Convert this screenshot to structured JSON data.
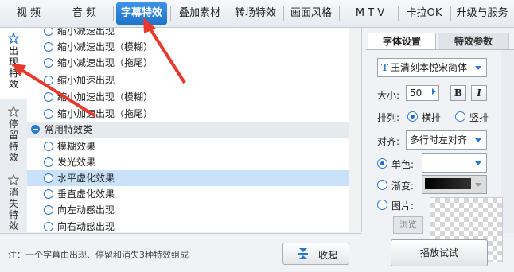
{
  "topbar": {
    "tabs": [
      "视 频",
      "音 频",
      "字幕特效",
      "叠加素材",
      "转场特效",
      "画面风格",
      "M T V",
      "卡拉OK",
      "升级与服务"
    ],
    "active_index": 2
  },
  "left_tabs": [
    {
      "label": "出\n现\n特\n效",
      "active": true
    },
    {
      "label": "停\n留\n特\n效",
      "active": false
    },
    {
      "label": "消\n失\n特\n效",
      "active": false
    }
  ],
  "list": {
    "items_top": [
      "缩小减速出现",
      "缩小减速出现（模糊）",
      "缩小减速出现（拖尾）",
      "缩小加速出现",
      "缩小加速出现（模糊）",
      "缩小加速出现（拖尾）"
    ],
    "group_label": "常用特效类",
    "items_group": [
      "模糊效果",
      "发光效果",
      "水平虚化效果",
      "垂直虚化效果",
      "向左动感出现",
      "向右动感出现"
    ],
    "selected": "水平虚化效果"
  },
  "bottom": {
    "note": "注：一个字幕由出现、停留和消失3种特效组成",
    "collapse_label": "收起"
  },
  "right": {
    "tabs": [
      "字体设置",
      "特效参数"
    ],
    "font_name": "王清刻本悦宋简体",
    "size_label": "大小:",
    "size_value": "50",
    "bold_label": "B",
    "italic_label": "I",
    "arrange_label": "排列:",
    "arrange_options": [
      "横排",
      "竖排"
    ],
    "align_label": "对齐:",
    "align_value": "多行时左对齐",
    "single_color_label": "单色:",
    "gradient_label": "渐变:",
    "picture_label": "图片:",
    "browse_label": "浏览",
    "play_label": "播放试试",
    "colors": {
      "accent": "#1f74c8",
      "arrow": "#e8392c"
    }
  }
}
